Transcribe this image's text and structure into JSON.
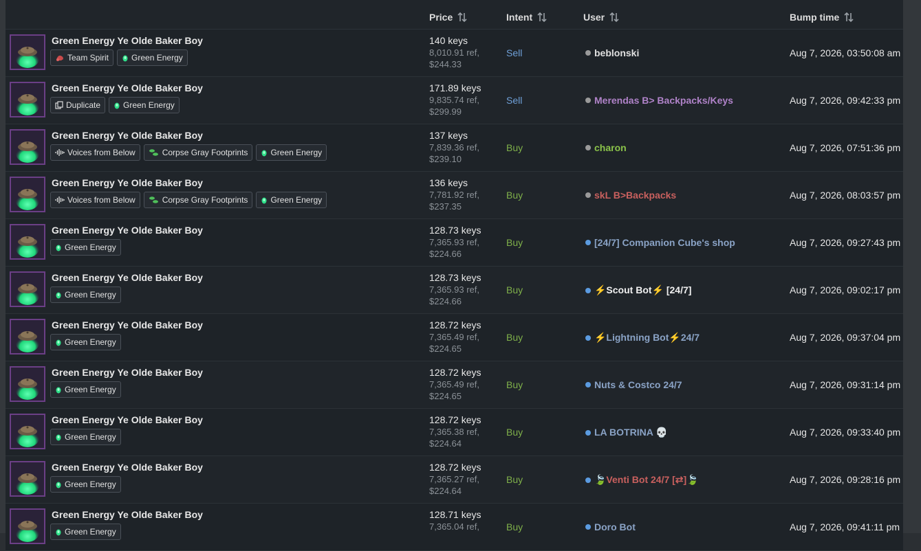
{
  "headers": {
    "price": "Price",
    "intent": "Intent",
    "user": "User",
    "bump": "Bump time"
  },
  "colors": {
    "sell": "#6fa0d8",
    "buy": "#7fb04a",
    "online_dot": "#5b9be0",
    "offline_dot": "#9a9a9a"
  },
  "rows": [
    {
      "name": "Green Energy Ye Olde Baker Boy",
      "attrs": [
        {
          "label": "Team Spirit",
          "icon": "team-spirit-icon"
        },
        {
          "label": "Green Energy",
          "icon": "green-energy-icon"
        }
      ],
      "keys": "140 keys",
      "ref": "8,010.91 ref,",
      "usd": "$244.33",
      "intent": "Sell",
      "intent_type": "sell",
      "user": "beblonski",
      "user_color": "#e0e0e0",
      "status": "offline",
      "bump": "Aug 7, 2026, 03:50:08 am"
    },
    {
      "name": "Green Energy Ye Olde Baker Boy",
      "attrs": [
        {
          "label": "Duplicate",
          "icon": "duplicate-icon"
        },
        {
          "label": "Green Energy",
          "icon": "green-energy-icon"
        }
      ],
      "keys": "171.89 keys",
      "ref": "9,835.74 ref,",
      "usd": "$299.99",
      "intent": "Sell",
      "intent_type": "sell",
      "user": "Merendas B> Backpacks/Keys",
      "user_color": "#b083c9",
      "status": "offline",
      "bump": "Aug 7, 2026, 09:42:33 pm"
    },
    {
      "name": "Green Energy Ye Olde Baker Boy",
      "attrs": [
        {
          "label": "Voices from Below",
          "icon": "voices-from-below-icon"
        },
        {
          "label": "Corpse Gray Footprints",
          "icon": "footprints-icon"
        },
        {
          "label": "Green Energy",
          "icon": "green-energy-icon"
        }
      ],
      "keys": "137 keys",
      "ref": "7,839.36 ref,",
      "usd": "$239.10",
      "intent": "Buy",
      "intent_type": "buy",
      "user": "charon",
      "user_color": "#8bc34a",
      "status": "offline",
      "bump": "Aug 7, 2026, 07:51:36 pm"
    },
    {
      "name": "Green Energy Ye Olde Baker Boy",
      "attrs": [
        {
          "label": "Voices from Below",
          "icon": "voices-from-below-icon"
        },
        {
          "label": "Corpse Gray Footprints",
          "icon": "footprints-icon"
        },
        {
          "label": "Green Energy",
          "icon": "green-energy-icon"
        }
      ],
      "keys": "136 keys",
      "ref": "7,781.92 ref,",
      "usd": "$237.35",
      "intent": "Buy",
      "intent_type": "buy",
      "user": "skL B>Backpacks",
      "user_color": "#c9605e",
      "status": "offline",
      "bump": "Aug 7, 2026, 08:03:57 pm"
    },
    {
      "name": "Green Energy Ye Olde Baker Boy",
      "attrs": [
        {
          "label": "Green Energy",
          "icon": "green-energy-icon"
        }
      ],
      "keys": "128.73 keys",
      "ref": "7,365.93 ref,",
      "usd": "$224.66",
      "intent": "Buy",
      "intent_type": "buy",
      "user": "[24/7] Companion Cube's shop",
      "user_color": "#8aa3c6",
      "status": "online",
      "bump": "Aug 7, 2026, 09:27:43 pm"
    },
    {
      "name": "Green Energy Ye Olde Baker Boy",
      "attrs": [
        {
          "label": "Green Energy",
          "icon": "green-energy-icon"
        }
      ],
      "keys": "128.73 keys",
      "ref": "7,365.93 ref,",
      "usd": "$224.66",
      "intent": "Buy",
      "intent_type": "buy",
      "user": "⚡Scout Bot⚡ [24/7]",
      "user_color": "#f0f0f0",
      "status": "online",
      "bump": "Aug 7, 2026, 09:02:17 pm"
    },
    {
      "name": "Green Energy Ye Olde Baker Boy",
      "attrs": [
        {
          "label": "Green Energy",
          "icon": "green-energy-icon"
        }
      ],
      "keys": "128.72 keys",
      "ref": "7,365.49 ref,",
      "usd": "$224.65",
      "intent": "Buy",
      "intent_type": "buy",
      "user": "⚡Lightning Bot⚡24/7",
      "user_color": "#8aa3c6",
      "status": "online",
      "bump": "Aug 7, 2026, 09:37:04 pm"
    },
    {
      "name": "Green Energy Ye Olde Baker Boy",
      "attrs": [
        {
          "label": "Green Energy",
          "icon": "green-energy-icon"
        }
      ],
      "keys": "128.72 keys",
      "ref": "7,365.49 ref,",
      "usd": "$224.65",
      "intent": "Buy",
      "intent_type": "buy",
      "user": "Nuts & Costco 24/7",
      "user_color": "#8aa3c6",
      "status": "online",
      "bump": "Aug 7, 2026, 09:31:14 pm"
    },
    {
      "name": "Green Energy Ye Olde Baker Boy",
      "attrs": [
        {
          "label": "Green Energy",
          "icon": "green-energy-icon"
        }
      ],
      "keys": "128.72 keys",
      "ref": "7,365.38 ref,",
      "usd": "$224.64",
      "intent": "Buy",
      "intent_type": "buy",
      "user": "LA BOTRINA 💀",
      "user_color": "#8aa3c6",
      "status": "online",
      "bump": "Aug 7, 2026, 09:33:40 pm"
    },
    {
      "name": "Green Energy Ye Olde Baker Boy",
      "attrs": [
        {
          "label": "Green Energy",
          "icon": "green-energy-icon"
        }
      ],
      "keys": "128.72 keys",
      "ref": "7,365.27 ref,",
      "usd": "$224.64",
      "intent": "Buy",
      "intent_type": "buy",
      "user": "🍃Venti Bot 24/7 [⇄]🍃",
      "user_color": "#c9605e",
      "status": "online",
      "bump": "Aug 7, 2026, 09:28:16 pm"
    },
    {
      "name": "Green Energy Ye Olde Baker Boy",
      "attrs": [
        {
          "label": "Green Energy",
          "icon": "green-energy-icon"
        }
      ],
      "keys": "128.71 keys",
      "ref": "7,365.04 ref,",
      "usd": "",
      "intent": "Buy",
      "intent_type": "buy",
      "user": "Doro Bot",
      "user_color": "#8aa3c6",
      "status": "online",
      "bump": "Aug 7, 2026, 09:41:11 pm"
    }
  ]
}
